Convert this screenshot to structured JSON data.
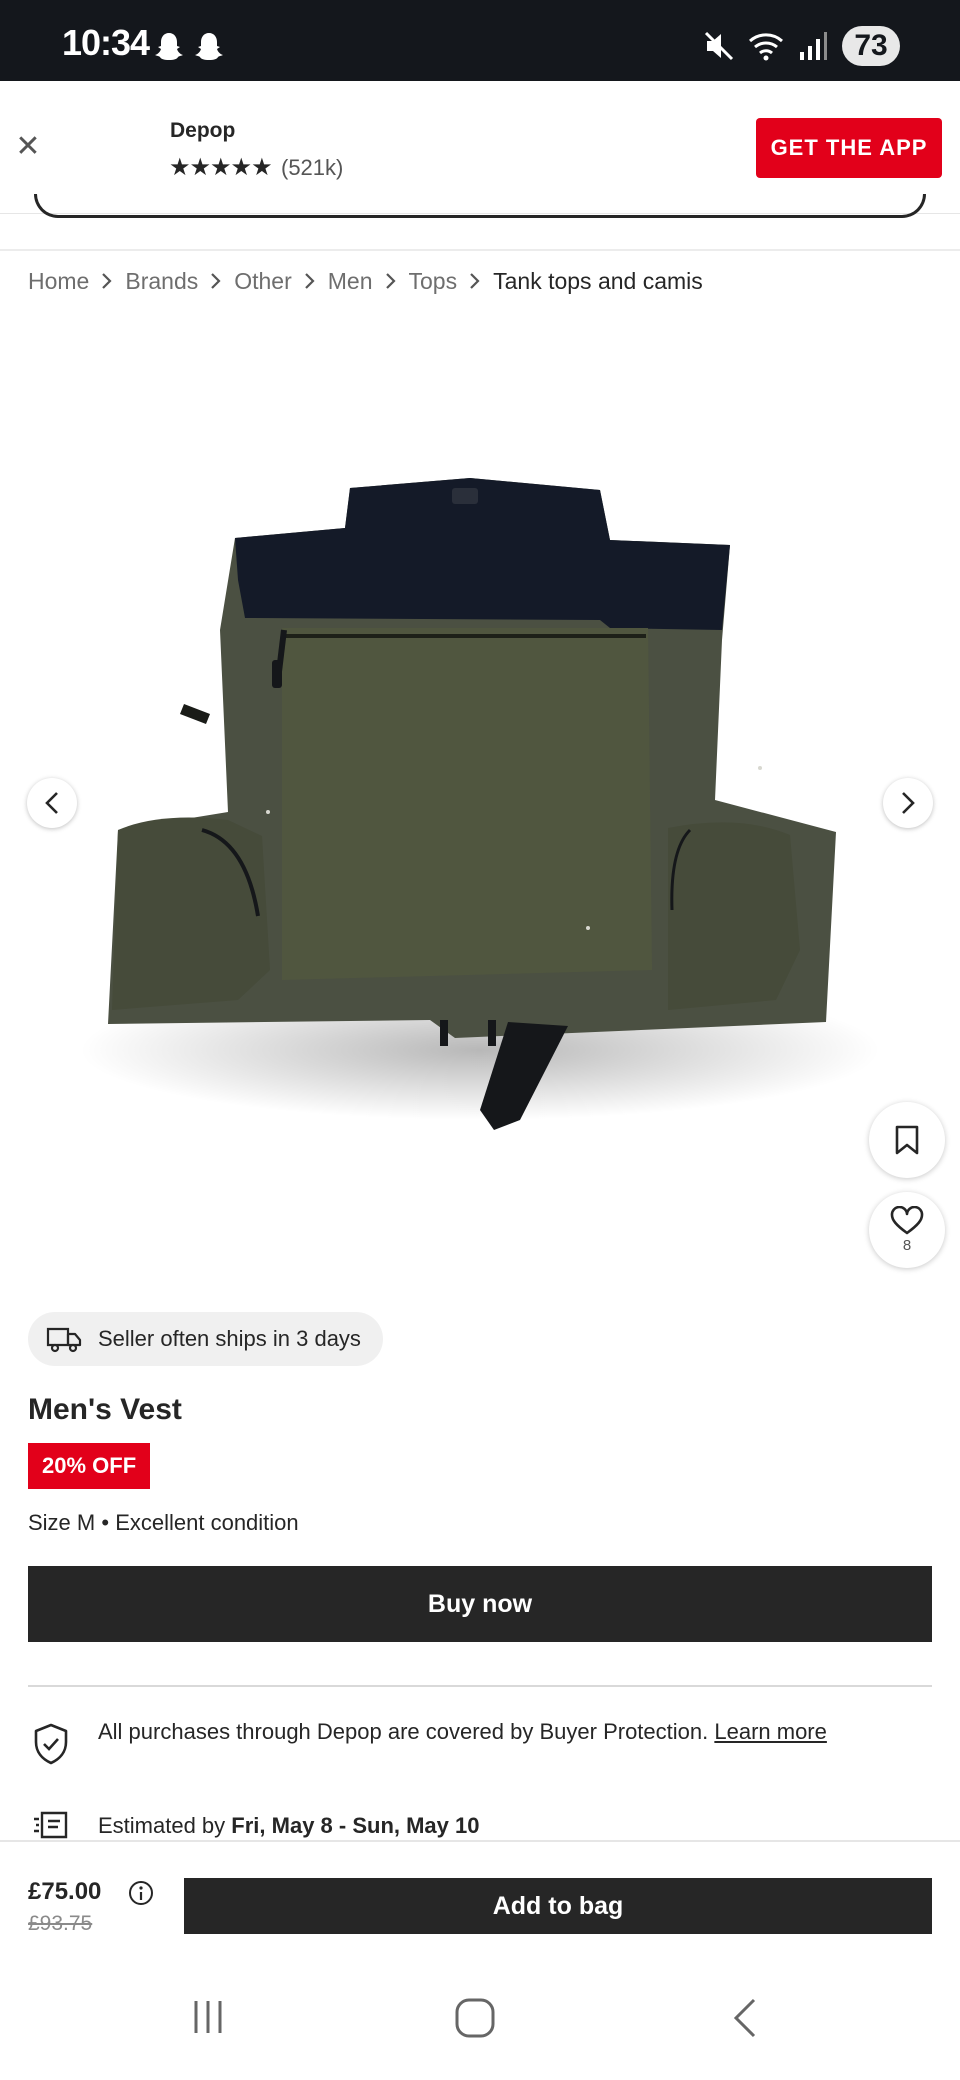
{
  "status_bar": {
    "time": "10:34",
    "battery": "73",
    "icons": [
      "snapchat-icon",
      "snapchat-icon",
      "mute-icon",
      "wifi-icon",
      "signal-icon",
      "battery-icon"
    ]
  },
  "app_banner": {
    "app_name": "Depop",
    "stars": "★★★★★",
    "review_count": "(521k)",
    "cta": "GET THE APP",
    "close_symbol": "✕"
  },
  "breadcrumb": {
    "items": [
      "Home",
      "Brands",
      "Other",
      "Men",
      "Tops",
      "Tank tops and camis"
    ]
  },
  "gallery": {
    "like_count": "8"
  },
  "product": {
    "shipping_note": "Seller often ships in 3 days",
    "title": "Men's Vest",
    "discount_badge": "20% OFF",
    "size": "Size M",
    "separator": "•",
    "condition": "Excellent condition",
    "buy_now": "Buy now",
    "protection_text": "All purchases through Depop are covered by Buyer Protection.",
    "protection_link": "Learn more",
    "delivery_prefix": "Estimated by",
    "delivery_dates": "Fri, May 8 - Sun, May 10"
  },
  "bag_bar": {
    "price": "£75.00",
    "original_price": "£93.75",
    "add_to_bag": "Add to bag"
  },
  "colors": {
    "brand_red": "#e2001a",
    "dark_button": "#262626",
    "status_bar_bg": "#14171c",
    "vest_olive": "#4b5042",
    "vest_navy": "#141a28"
  }
}
